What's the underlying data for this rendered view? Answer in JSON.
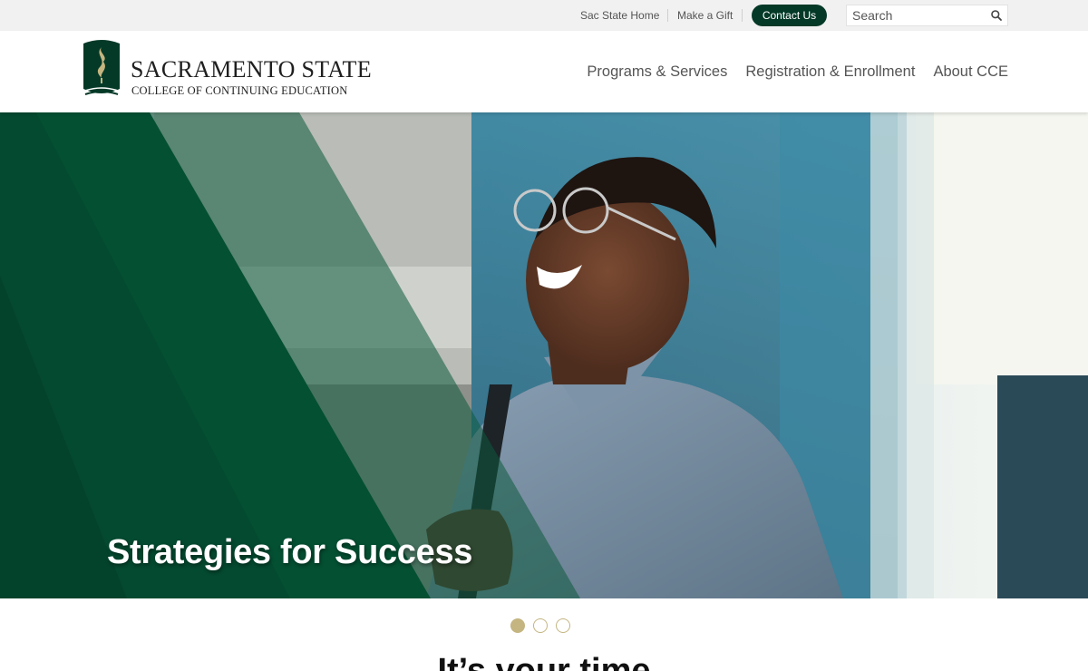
{
  "utility": {
    "links": [
      "Sac State Home",
      "Make a Gift"
    ],
    "contact_label": "Contact Us",
    "search_placeholder": "Search"
  },
  "logo": {
    "title": "SACRAMENTO STATE",
    "subtitle": "COLLEGE OF CONTINUING EDUCATION"
  },
  "nav": {
    "items": [
      "Programs & Services",
      "Registration & Enrollment",
      "About CCE"
    ]
  },
  "hero": {
    "heading": "Strategies for Success"
  },
  "carousel": {
    "slide_count": 3,
    "active_index": 0
  },
  "section": {
    "heading": "It’s your time"
  },
  "colors": {
    "brand_green": "#043927",
    "brand_gold": "#c4b581",
    "utility_bg": "#f1f1f1"
  }
}
